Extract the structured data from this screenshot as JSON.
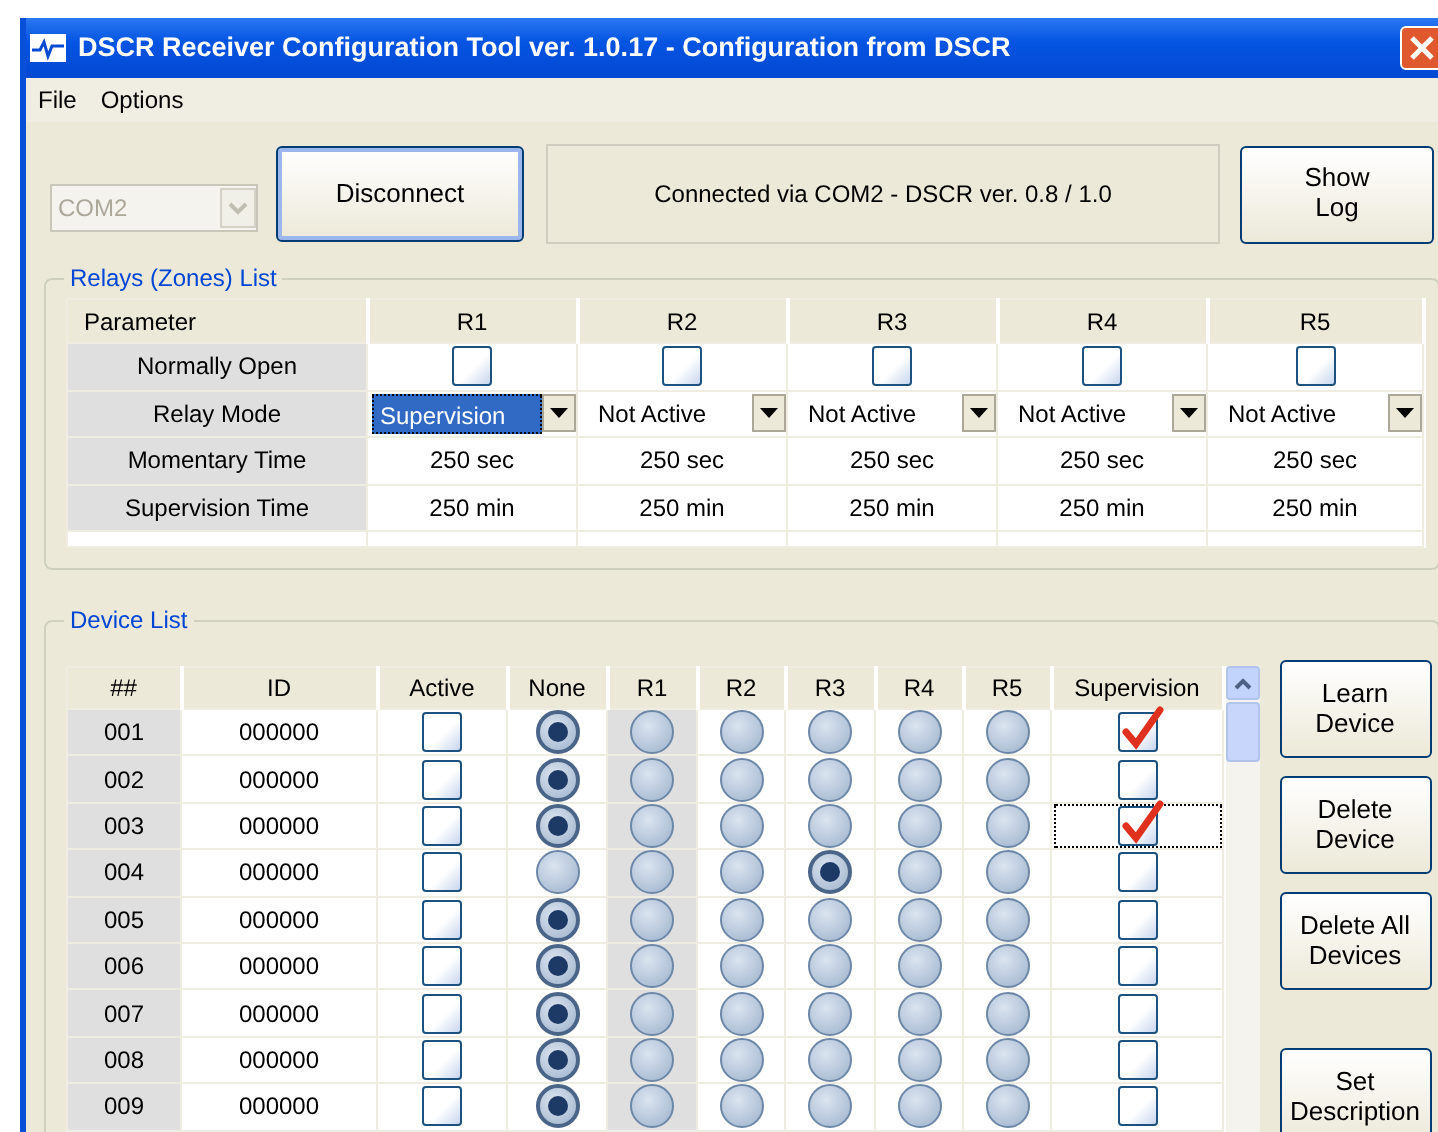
{
  "window": {
    "title": "DSCR Receiver Configuration Tool ver. 1.0.17 - Configuration from DSCR"
  },
  "menu": [
    "File",
    "Options"
  ],
  "toolbar": {
    "port": {
      "value": "COM2",
      "disabled": true
    },
    "connect_button": "Disconnect",
    "status": "Connected via COM2 - DSCR ver. 0.8 / 1.0",
    "log_button": "Show Log"
  },
  "relays": {
    "title": "Relays (Zones) List",
    "parameter_header": "Parameter",
    "columns": [
      "R1",
      "R2",
      "R3",
      "R4",
      "R5"
    ],
    "rows": [
      {
        "kind": "checkbox",
        "label": "Normally Open",
        "cells": [
          {
            "checked": false
          },
          {
            "checked": false
          },
          {
            "checked": false
          },
          {
            "checked": false
          },
          {
            "checked": false
          }
        ]
      },
      {
        "kind": "dropdown",
        "label": "Relay Mode",
        "cells": [
          {
            "value": "Supervision",
            "focused": true
          },
          {
            "value": "Not Active",
            "focused": false
          },
          {
            "value": "Not Active",
            "focused": false
          },
          {
            "value": "Not Active",
            "focused": false
          },
          {
            "value": "Not Active",
            "focused": false
          }
        ]
      },
      {
        "kind": "text",
        "label": "Momentary Time",
        "cells": [
          {
            "value": "250 sec"
          },
          {
            "value": "250 sec"
          },
          {
            "value": "250 sec"
          },
          {
            "value": "250 sec"
          },
          {
            "value": "250 sec"
          }
        ]
      },
      {
        "kind": "text",
        "label": "Supervision Time",
        "cells": [
          {
            "value": "250 min"
          },
          {
            "value": "250 min"
          },
          {
            "value": "250 min"
          },
          {
            "value": "250 min"
          },
          {
            "value": "250 min"
          }
        ]
      }
    ]
  },
  "devices": {
    "title": "Device List",
    "columns": [
      {
        "label": "##",
        "highlighted": true
      },
      {
        "label": "ID",
        "highlighted": false
      },
      {
        "label": "Active",
        "highlighted": false
      },
      {
        "label": "None",
        "highlighted": false
      },
      {
        "label": "R1",
        "highlighted": true
      },
      {
        "label": "R2",
        "highlighted": false
      },
      {
        "label": "R3",
        "highlighted": false
      },
      {
        "label": "R4",
        "highlighted": false
      },
      {
        "label": "R5",
        "highlighted": false
      },
      {
        "label": "Supervision",
        "highlighted": false
      }
    ],
    "rows": [
      {
        "number": "001",
        "id": "000000",
        "active": false,
        "outputs": [
          {
            "selected": true
          },
          {
            "selected": false
          },
          {
            "selected": false
          },
          {
            "selected": false
          },
          {
            "selected": false
          },
          {
            "selected": false
          }
        ],
        "supervision": true,
        "focused": false
      },
      {
        "number": "002",
        "id": "000000",
        "active": false,
        "outputs": [
          {
            "selected": true
          },
          {
            "selected": false
          },
          {
            "selected": false
          },
          {
            "selected": false
          },
          {
            "selected": false
          },
          {
            "selected": false
          }
        ],
        "supervision": false,
        "focused": false
      },
      {
        "number": "003",
        "id": "000000",
        "active": false,
        "outputs": [
          {
            "selected": true
          },
          {
            "selected": false
          },
          {
            "selected": false
          },
          {
            "selected": false
          },
          {
            "selected": false
          },
          {
            "selected": false
          }
        ],
        "supervision": true,
        "focused": true
      },
      {
        "number": "004",
        "id": "000000",
        "active": false,
        "outputs": [
          {
            "selected": false
          },
          {
            "selected": false
          },
          {
            "selected": false
          },
          {
            "selected": true
          },
          {
            "selected": false
          },
          {
            "selected": false
          }
        ],
        "supervision": false,
        "focused": false
      },
      {
        "number": "005",
        "id": "000000",
        "active": false,
        "outputs": [
          {
            "selected": true
          },
          {
            "selected": false
          },
          {
            "selected": false
          },
          {
            "selected": false
          },
          {
            "selected": false
          },
          {
            "selected": false
          }
        ],
        "supervision": false,
        "focused": false
      },
      {
        "number": "006",
        "id": "000000",
        "active": false,
        "outputs": [
          {
            "selected": true
          },
          {
            "selected": false
          },
          {
            "selected": false
          },
          {
            "selected": false
          },
          {
            "selected": false
          },
          {
            "selected": false
          }
        ],
        "supervision": false,
        "focused": false
      },
      {
        "number": "007",
        "id": "000000",
        "active": false,
        "outputs": [
          {
            "selected": true
          },
          {
            "selected": false
          },
          {
            "selected": false
          },
          {
            "selected": false
          },
          {
            "selected": false
          },
          {
            "selected": false
          }
        ],
        "supervision": false,
        "focused": false
      },
      {
        "number": "008",
        "id": "000000",
        "active": false,
        "outputs": [
          {
            "selected": true
          },
          {
            "selected": false
          },
          {
            "selected": false
          },
          {
            "selected": false
          },
          {
            "selected": false
          },
          {
            "selected": false
          }
        ],
        "supervision": false,
        "focused": false
      },
      {
        "number": "009",
        "id": "000000",
        "active": false,
        "outputs": [
          {
            "selected": true
          },
          {
            "selected": false
          },
          {
            "selected": false
          },
          {
            "selected": false
          },
          {
            "selected": false
          },
          {
            "selected": false
          }
        ],
        "supervision": false,
        "focused": false
      }
    ]
  },
  "buttons": [
    "Learn Device",
    "Delete Device",
    "Delete All Devices",
    "Set Description"
  ]
}
